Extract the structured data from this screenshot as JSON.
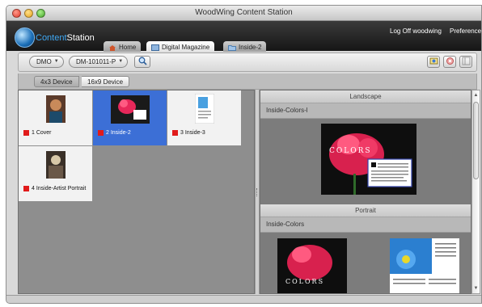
{
  "window": {
    "title": "WoodWing Content Station"
  },
  "app": {
    "logo_text_content": "Content",
    "logo_text_station": "Station"
  },
  "header": {
    "logoff": "Log Off woodwing",
    "preferences": "Preferences"
  },
  "tabs": [
    {
      "label": "Home",
      "icon": "home-icon"
    },
    {
      "label": "Digital Magazine",
      "icon": "magazine-icon"
    },
    {
      "label": "Inside-2",
      "icon": "folder-icon"
    }
  ],
  "toolbar": {
    "brand_select": "DMO",
    "issue_select": "DM-101011-P",
    "search_icon": "magnifier-icon",
    "right_icons": [
      "preview-icon",
      "settings-icon",
      "panel-icon"
    ]
  },
  "devices": {
    "option_1": "4x3 Device",
    "option_2": "16x9 Device",
    "selected": "4x3 Device"
  },
  "pages": [
    {
      "label": "1 Cover",
      "status_color": "#e11b1b"
    },
    {
      "label": "2 Inside-2",
      "status_color": "#e11b1b",
      "selected": true
    },
    {
      "label": "3 Inside-3",
      "status_color": "#e11b1b"
    },
    {
      "label": "4 Inside-Artist Portrait",
      "status_color": "#e11b1b"
    }
  ],
  "preview": {
    "landscape": {
      "heading": "Landscape",
      "sub": "Inside-Colors-l",
      "title_word": "COLORS"
    },
    "portrait": {
      "heading": "Portrait",
      "sub": "Inside-Colors",
      "title_word": "COLORS"
    }
  },
  "colors": {
    "selection": "#3c6fd6",
    "accent": "#3fa9f5",
    "status_red": "#e11b1b"
  }
}
